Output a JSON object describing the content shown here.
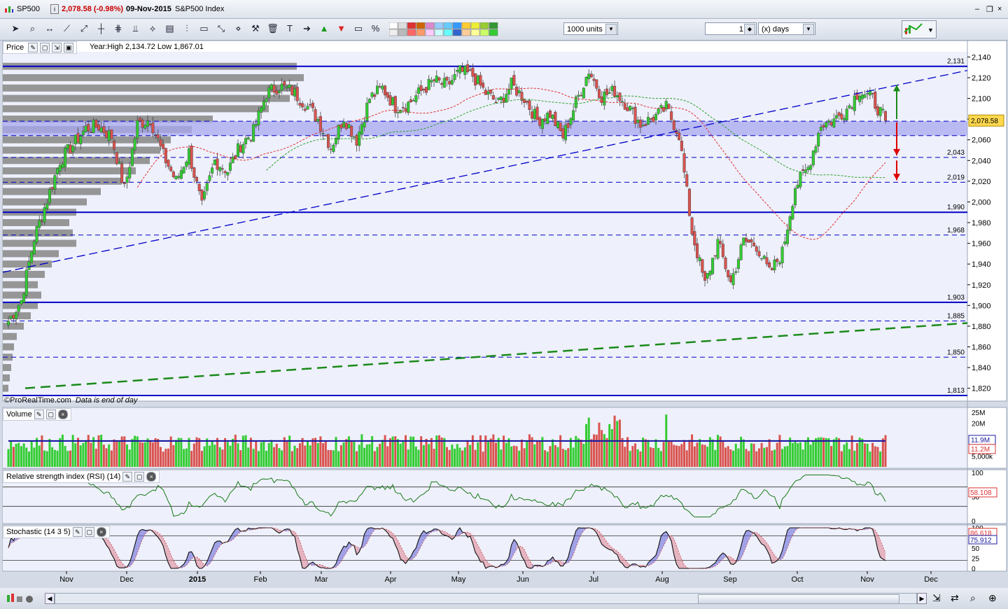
{
  "title": {
    "ticker": "SP500",
    "info_icon": "i",
    "last": "2,078.58 (-0.98%)",
    "date": "09-Nov-2015",
    "name": "S&P500 Index",
    "window_controls": [
      "–",
      "❐",
      "×"
    ]
  },
  "toolbar": {
    "units": "1000 units",
    "count": "1",
    "period": "(x) days",
    "icons": [
      "cursor-icon",
      "zoom-icon",
      "hline-icon",
      "line-icon",
      "trend-icon",
      "vline-icon",
      "channel-icon",
      "fork-icon",
      "fan-icon",
      "fib-icon",
      "gann-icon",
      "ruler-icon",
      "arrows-icon",
      "pitch-icon",
      "tools-icon",
      "trash-icon",
      "text-icon",
      "right-arrow-icon",
      "up-arrow-icon",
      "down-arrow-icon",
      "rect-icon",
      "percent-icon"
    ]
  },
  "colors": {
    "bg_plot": "#eef0fb",
    "up": "#33cc33",
    "down": "#d9534f",
    "level": "#0000c8",
    "band": "#a8a8f0",
    "profile": "#8c8c8c",
    "green_trend": "#1a8a1a",
    "ma_red": "#e03030",
    "ma_green": "#2aa22a",
    "rsi_line": "#1a7a1a"
  },
  "price_panel": {
    "label": "Price",
    "year_info": "Year:High 2,134.72 Low 1,867.01",
    "footer_brand": "©ProRealTime.com",
    "footer_note": "Data is end of day",
    "current_tag": "2,078.58"
  },
  "volume_panel": {
    "label": "Volume",
    "tags": [
      "11.9M",
      "11.2M"
    ]
  },
  "rsi_panel": {
    "label": "Relative strength index (RSI) (14)",
    "tag": "58.108"
  },
  "stoch_panel": {
    "label": "Stochastic (14 3 5)",
    "tags": [
      "86.618",
      "75.912"
    ]
  },
  "chart_data": {
    "type": "candlestick",
    "symbol": "SP500",
    "ylim": [
      1813,
      2145
    ],
    "y_ticks": [
      "2,140",
      "2,120",
      "2,100",
      "2,080",
      "2,060",
      "2,040",
      "2,020",
      "2,000",
      "1,980",
      "1,960",
      "1,940",
      "1,920",
      "1,900",
      "1,880",
      "1,860",
      "1,840",
      "1,820"
    ],
    "x_months": [
      "Nov",
      "Dec",
      "2015",
      "Feb",
      "Mar",
      "Apr",
      "May",
      "Jun",
      "Jul",
      "Aug",
      "Sep",
      "Oct",
      "Nov",
      "Dec"
    ],
    "horizontal_levels": [
      {
        "value": 2131,
        "label": "2,131",
        "style": "solid"
      },
      {
        "value": 2078,
        "label": "",
        "style": "dashed"
      },
      {
        "value": 2064,
        "label": "",
        "style": "dashed"
      },
      {
        "value": 2043,
        "label": "2,043",
        "style": "dashed"
      },
      {
        "value": 2019,
        "label": "2,019",
        "style": "dashed"
      },
      {
        "value": 1990,
        "label": "1,990",
        "style": "solid"
      },
      {
        "value": 1968,
        "label": "1,968",
        "style": "dashed"
      },
      {
        "value": 1903,
        "label": "1,903",
        "style": "solid"
      },
      {
        "value": 1885,
        "label": "1,885",
        "style": "dashed"
      },
      {
        "value": 1850,
        "label": "1,850",
        "style": "dashed"
      },
      {
        "value": 1813,
        "label": "1,813",
        "style": "solid"
      }
    ],
    "resistance_band": [
      2064,
      2078
    ],
    "trendlines": [
      {
        "name": "blue-rising",
        "from": [
          "Oct 2014",
          1932
        ],
        "to": [
          "Dec 2015",
          2127
        ]
      },
      {
        "name": "green-support",
        "from": [
          "Oct 2014",
          1820
        ],
        "to": [
          "Dec 2015",
          1883
        ]
      }
    ],
    "weekly_closes": [
      1885,
      1905,
      1965,
      2002,
      2040,
      2055,
      2071,
      2073,
      2063,
      2012,
      2075,
      2080,
      2045,
      2020,
      2048,
      1995,
      2040,
      2030,
      2055,
      2068,
      2105,
      2112,
      2107,
      2095,
      2080,
      2053,
      2082,
      2060,
      2100,
      2110,
      2092,
      2095,
      2107,
      2117,
      2112,
      2126,
      2122,
      2105,
      2095,
      2113,
      2100,
      2079,
      2085,
      2063,
      2096,
      2127,
      2102,
      2107,
      2093,
      2075,
      2081,
      2091,
      2065,
      1971,
      1920,
      1961,
      1922,
      1962,
      1958,
      1931,
      1951,
      2015,
      2033,
      2075,
      2079,
      2090,
      2108,
      2099,
      2078.58
    ],
    "rsi": {
      "upper": 70,
      "lower": 30,
      "last": 58.108,
      "ticks": [
        "100",
        "50",
        "0"
      ]
    },
    "stochastic": {
      "upper": 80,
      "lower": 20,
      "k_last": 86.618,
      "d_last": 75.912,
      "ticks": [
        "100",
        "75",
        "50",
        "25",
        "0"
      ]
    },
    "volume_ticks": [
      "25M",
      "20M",
      "5,000k"
    ]
  }
}
